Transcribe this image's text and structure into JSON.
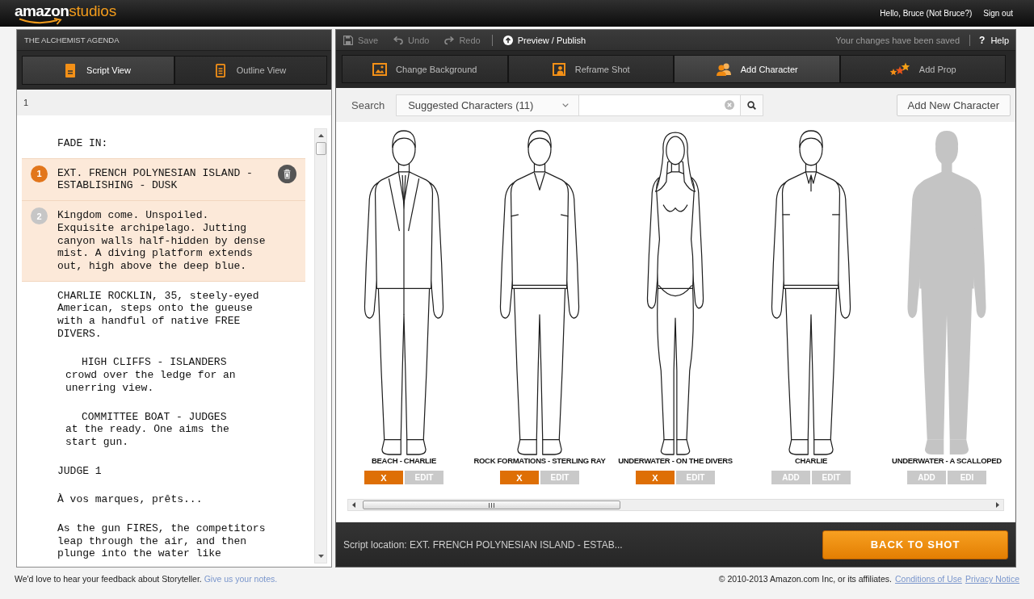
{
  "top_bar": {
    "logo": {
      "brand": "amazon",
      "product": "studios"
    },
    "greeting": "Hello, Bruce (Not Bruce?)",
    "sign_out": "Sign out"
  },
  "script_panel": {
    "title": "THE ALCHEMIST AGENDA",
    "tabs": [
      {
        "kind": "script",
        "label": "Script View",
        "selected": true
      },
      {
        "kind": "outline",
        "label": "Outline View",
        "selected": false
      }
    ],
    "page_number": "1",
    "elements": [
      {
        "kind": "transition",
        "text": "FADE IN:",
        "highlighted": false
      },
      {
        "kind": "scene",
        "text": "EXT. FRENCH POLYNESIAN ISLAND - ESTABLISHING - DUSK",
        "highlighted": true,
        "badge": {
          "number": "1",
          "active": true
        }
      },
      {
        "kind": "action",
        "text": "Kingdom come. Unspoiled. Exquisite archipelago. Jutting canyon walls half-hidden by dense mist. A diving platform extends out, high above the deep blue.",
        "highlighted": true,
        "badge": {
          "number": "2",
          "active": false
        }
      },
      {
        "kind": "action",
        "text": "CHARLIE ROCKLIN, 35, steely-eyed American, steps onto the gueuse with a handful of native FREE DIVERS.",
        "highlighted": false
      },
      {
        "kind": "shot",
        "heading": "HIGH CLIFFS - ISLANDERS",
        "text": "crowd over the ledge for an unerring view.",
        "highlighted": false
      },
      {
        "kind": "shot",
        "heading": "COMMITTEE BOAT - JUDGES",
        "text": "at the ready. One aims the start gun.",
        "highlighted": false
      },
      {
        "kind": "character",
        "text": "JUDGE 1",
        "highlighted": false
      },
      {
        "kind": "dialogue",
        "text": "À vos marques, prêts...",
        "highlighted": false
      },
      {
        "kind": "action",
        "text": "As the gun FIRES, the competitors leap through the air, and then plunge into the water like",
        "highlighted": false
      }
    ]
  },
  "editor_panel": {
    "toolbar": {
      "actions": [
        {
          "kind": "save",
          "label": "Save",
          "disabled": true
        },
        {
          "kind": "undo",
          "label": "Undo",
          "disabled": true
        },
        {
          "kind": "redo",
          "label": "Redo",
          "disabled": true
        },
        {
          "kind": "preview",
          "label": "Preview / Publish",
          "disabled": false
        }
      ],
      "status": "Your changes have been saved",
      "help": {
        "icon": "?",
        "label": "Help"
      }
    },
    "tabs": [
      {
        "kind": "background",
        "label": "Change Background",
        "selected": false
      },
      {
        "kind": "reframe",
        "label": "Reframe Shot",
        "selected": false
      },
      {
        "kind": "character",
        "label": "Add Character",
        "selected": true
      },
      {
        "kind": "prop",
        "label": "Add Prop",
        "selected": false
      }
    ],
    "search": {
      "label": "Search",
      "filter": "Suggested Characters (11)",
      "add_button": "Add New Character"
    },
    "characters": [
      {
        "kind": "drawing",
        "name": "BEACH - CHARLIE",
        "added": true,
        "action": "X",
        "edit": "EDIT"
      },
      {
        "kind": "drawing",
        "name": "ROCK FORMATIONS - STERLING RAY",
        "added": true,
        "action": "X",
        "edit": "EDIT"
      },
      {
        "kind": "drawing",
        "name": "UNDERWATER - ON THE DIVERS",
        "added": true,
        "action": "X",
        "edit": "EDIT"
      },
      {
        "kind": "drawing",
        "name": "CHARLIE",
        "added": false,
        "action": "ADD",
        "edit": "EDIT"
      },
      {
        "kind": "silhouette",
        "name": "UNDERWATER - A SCALLOPED",
        "added": false,
        "action": "ADD",
        "edit": "EDI"
      }
    ],
    "script_location": "Script location: EXT. FRENCH POLYNESIAN ISLAND - ESTAB...",
    "back_button": "BACK TO SHOT"
  },
  "footer": {
    "feedback": "We'd love to hear your feedback about Storyteller.",
    "feedback_link": "Give us your notes.",
    "copyright": "© 2010-2013 Amazon.com Inc, or its affiliates.",
    "links": [
      "Conditions of Use",
      "Privacy Notice"
    ]
  }
}
